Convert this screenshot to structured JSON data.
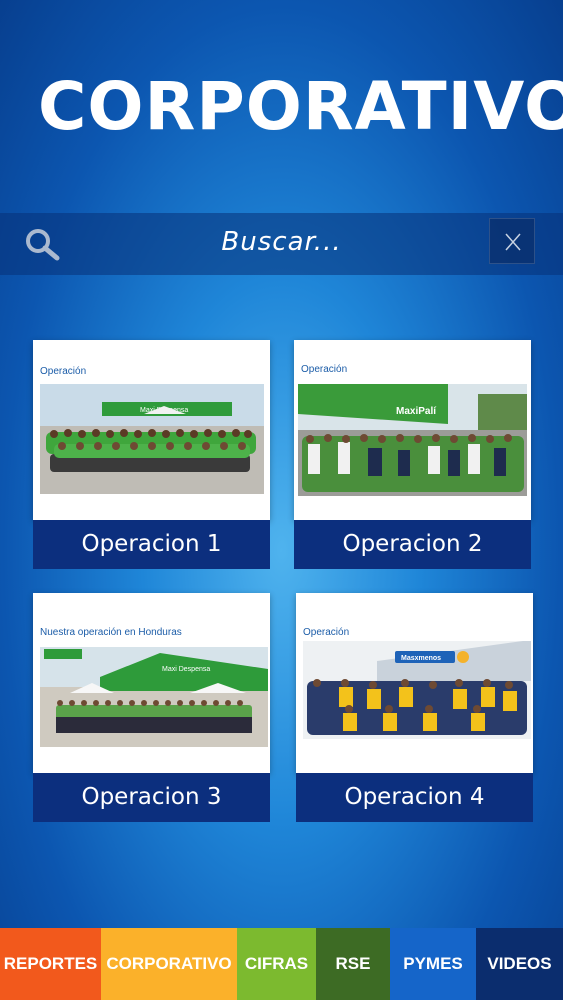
{
  "header": {
    "title": "CORPORATIVO"
  },
  "search": {
    "placeholder": "Buscar..."
  },
  "cards": [
    {
      "caption": "Operación",
      "label": "Operacion 1",
      "sign": "Maxi Despensa"
    },
    {
      "caption": "Operación",
      "label": "Operacion 2",
      "sign": "MaxiPalí"
    },
    {
      "caption": "Nuestra operación en Honduras",
      "label": "Operacion 3",
      "sign": "Maxi Despensa"
    },
    {
      "caption": "Operación",
      "label": "Operacion 4",
      "sign": "Masxmenos"
    }
  ],
  "nav": [
    {
      "label": "REPORTES",
      "color": "#f2591c"
    },
    {
      "label": "CORPORATIVO",
      "color": "#fbb12a"
    },
    {
      "label": "CIFRAS",
      "color": "#7cba2f"
    },
    {
      "label": "RSE",
      "color": "#3d6b24"
    },
    {
      "label": "PYMES",
      "color": "#1565c9"
    },
    {
      "label": "VIDEOS",
      "color": "#0b2d6e"
    }
  ]
}
